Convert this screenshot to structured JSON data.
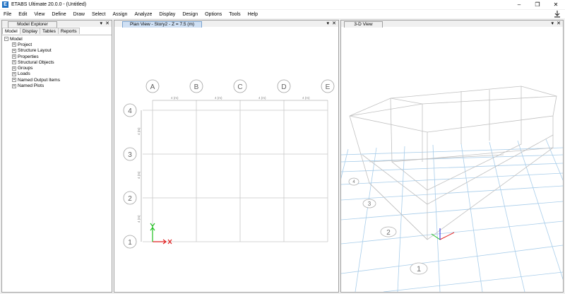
{
  "app": {
    "icon_letter": "E",
    "title": "ETABS Ultimate 20.0.0 - (Untitled)"
  },
  "window_controls": {
    "minimize": "–",
    "maximize": "❐",
    "close": "✕"
  },
  "menu": [
    "File",
    "Edit",
    "View",
    "Define",
    "Draw",
    "Select",
    "Assign",
    "Analyze",
    "Display",
    "Design",
    "Options",
    "Tools",
    "Help"
  ],
  "explorer": {
    "title": "Model Explorer",
    "tabs": [
      "Model",
      "Display",
      "Tables",
      "Reports"
    ],
    "root": "Model",
    "items": [
      "Project",
      "Structure Layout",
      "Properties",
      "Structural Objects",
      "Groups",
      "Loads",
      "Named Output Items",
      "Named Plots"
    ]
  },
  "plan_view": {
    "title": "Plan View - Story2 - Z = 7.5 (m)",
    "grid_x": [
      "A",
      "B",
      "C",
      "D",
      "E"
    ],
    "grid_y": [
      "4",
      "3",
      "2",
      "1"
    ],
    "spacing_label": "4 (m)"
  },
  "view3d": {
    "title": "3-D View",
    "grid_labels": [
      "1",
      "2",
      "3",
      "4"
    ]
  },
  "panel_controls": {
    "pin": "▾",
    "close": "✕"
  },
  "colors": {
    "axis_x": "#e02020",
    "axis_y": "#20c020",
    "axis_z": "#2020e0",
    "grid_blue": "#a8cdea",
    "active_tab": "#cfe0f4"
  }
}
